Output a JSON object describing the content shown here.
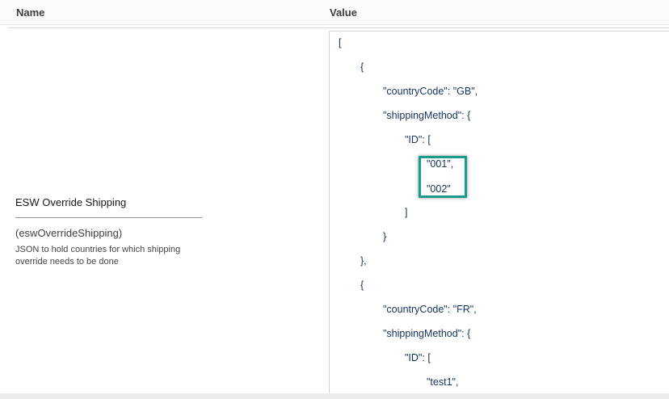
{
  "table": {
    "headers": {
      "name": "Name",
      "value": "Value"
    },
    "field": {
      "label": "ESW Override Shipping",
      "api_name": "(eswOverrideShipping)",
      "description": "JSON to hold countries for which shipping override needs to be done"
    },
    "json_lines": [
      "[",
      "{",
      "\"countryCode\": \"GB\",",
      "\"shippingMethod\": {",
      "\"ID\": [",
      "\"001\",",
      "\"002\"",
      "]",
      "}",
      "},",
      "{",
      "\"countryCode\": \"FR\",",
      "\"shippingMethod\": {",
      "\"ID\": [",
      "\"test1\","
    ]
  },
  "colors": {
    "highlight": "#1a9c8c",
    "json_text": "#16325c"
  }
}
